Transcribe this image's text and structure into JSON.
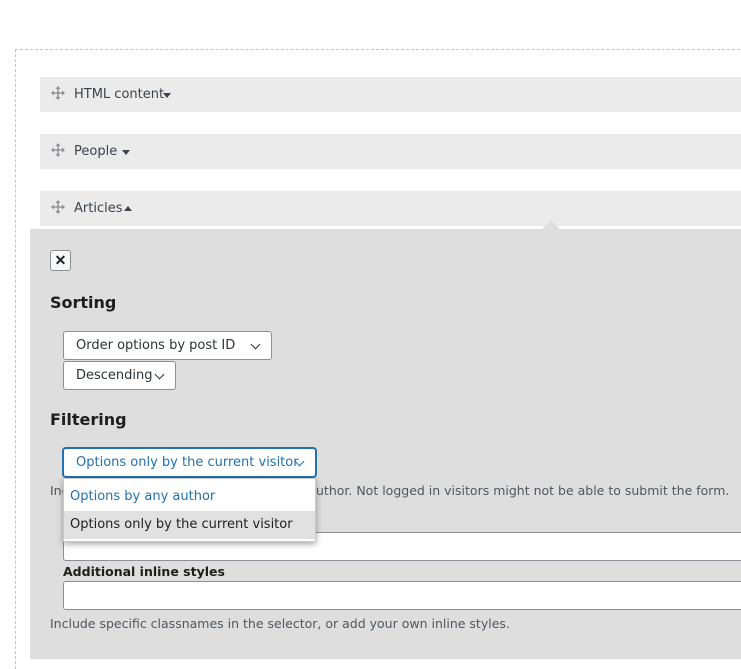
{
  "blocks": [
    {
      "label": "HTML content",
      "expanded": false
    },
    {
      "label": "People",
      "expanded": false
    },
    {
      "label": "Articles",
      "expanded": true
    }
  ],
  "icons": {
    "move": "move-arrows-icon",
    "close": "close-x-icon",
    "collapsed": "caret-down-icon",
    "expanded": "caret-up-icon",
    "select": "chevron-down-icon"
  },
  "close_label": "✕",
  "sorting": {
    "heading": "Sorting",
    "order_by": "Order options by post ID",
    "direction": "Descending"
  },
  "filtering": {
    "heading": "Filtering",
    "selected": "Options only by the current visitor",
    "options": [
      "Options by any author",
      "Options only by the current visitor"
    ],
    "help_left": "Inc",
    "help_right": "uthor. Not logged in visitors might not be able to submit the form."
  },
  "styles": {
    "label": "Additional inline styles",
    "help": "Include specific classnames in the selector, or add your own inline styles."
  },
  "colors": {
    "accent": "#2271b1",
    "panel": "#dedede",
    "bar": "#ebebeb"
  }
}
